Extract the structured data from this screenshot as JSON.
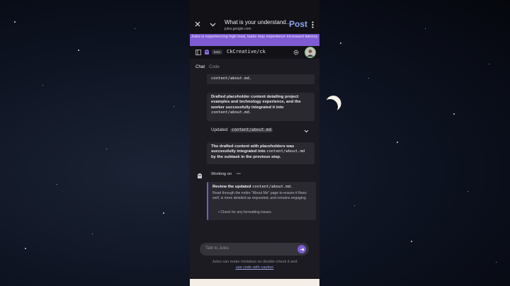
{
  "browser": {
    "page_title": "What is your understand...",
    "url": "jules.google.com",
    "post_label": "Post"
  },
  "banner": {
    "text": "Jules is experiencing high load, tasks may experience increased latency."
  },
  "app": {
    "beta_label": "beta",
    "repo_name": "CkCreative/ck"
  },
  "tabs": {
    "chat": "Chat",
    "code": "Code"
  },
  "messages": {
    "top_partial_code": "content/about.md.",
    "msg1_text": "Drafted placeholder content detailing project examples and technology experience, and the worker successfully integrated it into",
    "msg1_code": "content/about.md.",
    "updated_label": "Updated",
    "updated_file": "content/about.md",
    "msg2_text_a": "The drafted content with placeholders was successfully integrated into",
    "msg2_code": "content/about.md",
    "msg2_text_b": "by the subtask in the previous step."
  },
  "working": {
    "label": "Working on",
    "dots": "•••"
  },
  "review": {
    "title_prefix": "Review the updated",
    "title_code": "content/about.md.",
    "body": "Read through the entire \"About Me\" page to ensure it flows well, is more detailed as requested, and remains engaging.",
    "bullet": "Check for any formatting issues."
  },
  "chat": {
    "placeholder": "Talk to Jules"
  },
  "disclaimer": {
    "line1": "Jules can make mistakes so double-check it and",
    "link": "use code with caution"
  }
}
